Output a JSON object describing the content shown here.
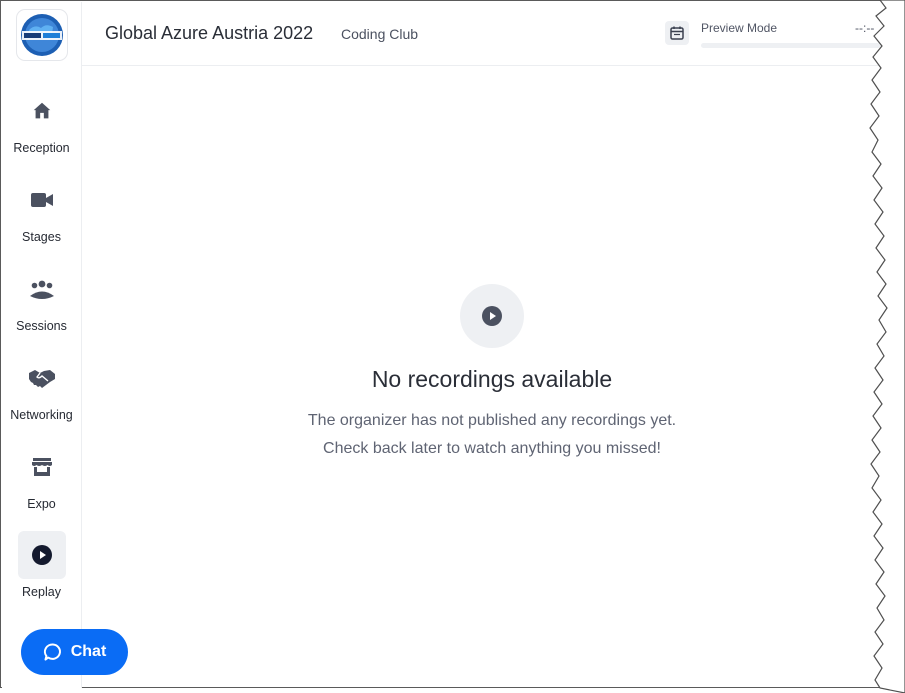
{
  "header": {
    "event_title": "Global Azure Austria 2022",
    "club": "Coding Club",
    "preview_label": "Preview Mode",
    "preview_time": "--:--"
  },
  "sidebar": {
    "items": [
      {
        "label": "Reception",
        "icon": "home-icon"
      },
      {
        "label": "Stages",
        "icon": "video-camera-icon"
      },
      {
        "label": "Sessions",
        "icon": "group-icon"
      },
      {
        "label": "Networking",
        "icon": "handshake-icon"
      },
      {
        "label": "Expo",
        "icon": "store-icon"
      },
      {
        "label": "Replay",
        "icon": "play-circle-icon",
        "active": true
      }
    ]
  },
  "empty_state": {
    "title": "No recordings available",
    "line1": "The organizer has not published any recordings yet.",
    "line2": "Check back later to watch anything you missed!"
  },
  "chat": {
    "label": "Chat"
  },
  "colors": {
    "accent": "#0a6cf5",
    "icon": "#4b5160",
    "active_bg": "#eef0f3"
  }
}
